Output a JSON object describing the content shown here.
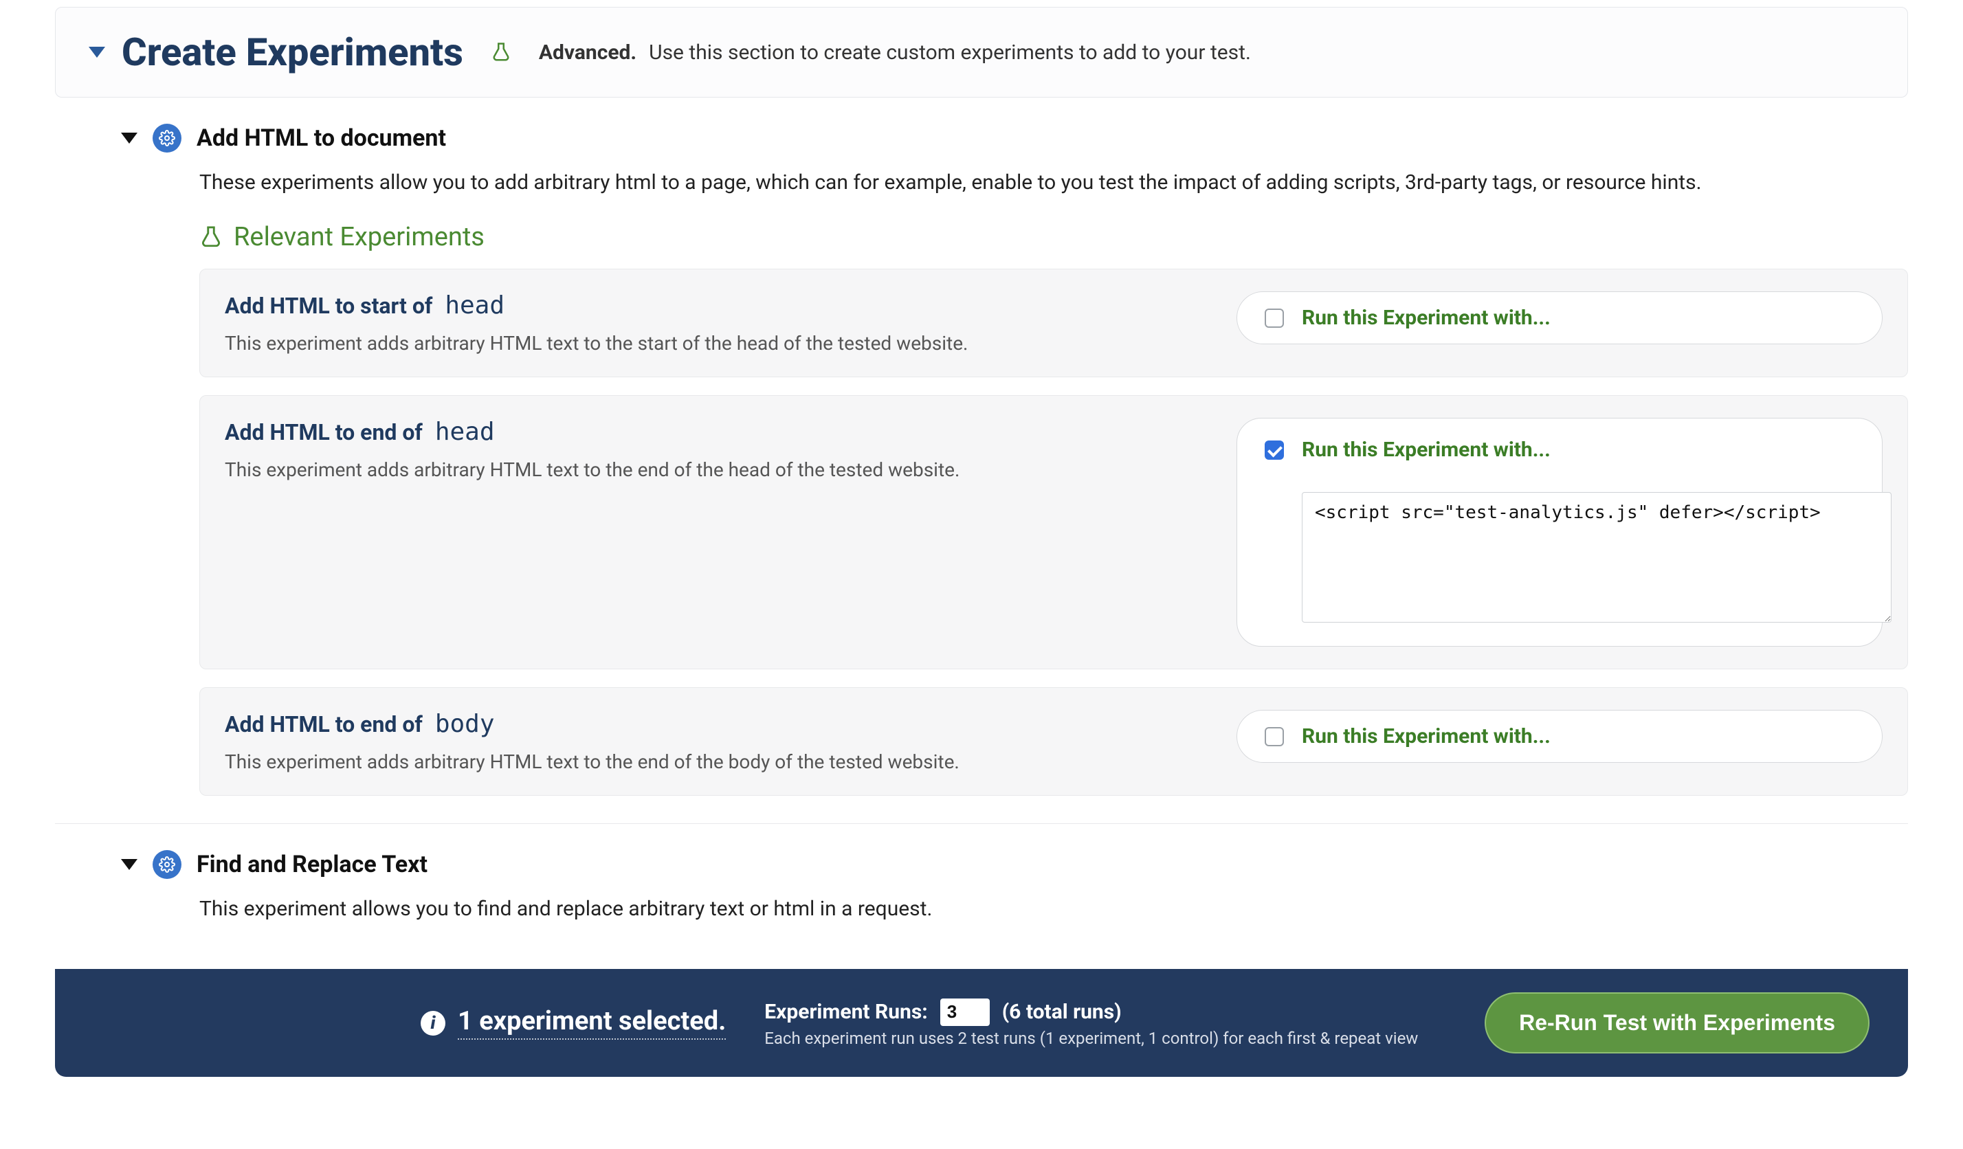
{
  "header": {
    "title": "Create Experiments",
    "advanced_label": "Advanced.",
    "advanced_desc": "Use this section to create custom experiments to add to your test."
  },
  "sections": {
    "addHtml": {
      "title": "Add HTML to document",
      "desc": "These experiments allow you to add arbitrary html to a page, which can for example, enable to you test the impact of adding scripts, 3rd-party tags, or resource hints.",
      "relevant_heading": "Relevant Experiments",
      "cards": [
        {
          "title_prefix": "Add HTML to start of",
          "title_target": "head",
          "desc": "This experiment adds arbitrary HTML text to the start of the head of the tested website.",
          "run_label": "Run this Experiment with...",
          "checked": false
        },
        {
          "title_prefix": "Add HTML to end of",
          "title_target": "head",
          "desc": "This experiment adds arbitrary HTML text to the end of the head of the tested website.",
          "run_label": "Run this Experiment with...",
          "checked": true,
          "code_value": "<script src=\"test-analytics.js\" defer></script>"
        },
        {
          "title_prefix": "Add HTML to end of",
          "title_target": "body",
          "desc": "This experiment adds arbitrary HTML text to the end of the body of the tested website.",
          "run_label": "Run this Experiment with...",
          "checked": false
        }
      ]
    },
    "findReplace": {
      "title": "Find and Replace Text",
      "desc": "This experiment allows you to find and replace arbitrary text or html in a request."
    }
  },
  "bottomBar": {
    "selected_count_text": "1 experiment selected.",
    "runs_label": "Experiment Runs:",
    "runs_value": "3",
    "total_runs_text": "(6 total runs)",
    "runs_note": "Each experiment run uses 2 test runs (1 experiment, 1 control) for each first & repeat view",
    "rerun_label": "Re-Run Test with Experiments"
  }
}
